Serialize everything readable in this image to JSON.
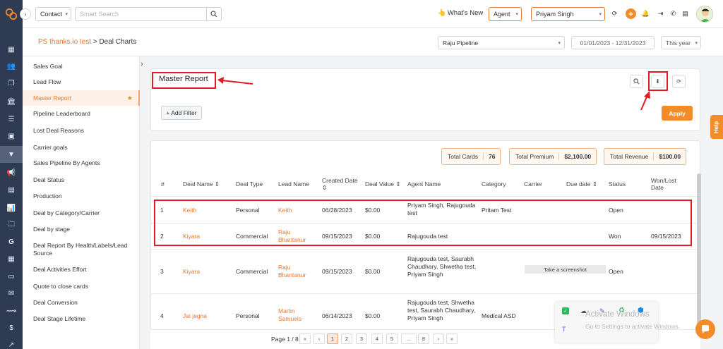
{
  "topbar": {
    "contact_select": "Contact",
    "search_placeholder": "Smart Search",
    "whats_new": "What's New",
    "agent_select": "Agent",
    "user_select": "Priyam Singh"
  },
  "breadcrumb": {
    "parent": "PS thanks.io test",
    "separator": " > ",
    "current": "Deal Charts"
  },
  "filters": {
    "pipeline": "Raju Pipeline",
    "date_range": "01/01/2023 - 12/31/2023",
    "period": "This year"
  },
  "menu": {
    "items": [
      {
        "label": "Sales Goal"
      },
      {
        "label": "Lead Flow"
      },
      {
        "label": "Master Report",
        "active": true
      },
      {
        "label": "Pipeline Leaderboard"
      },
      {
        "label": "Lost Deal Reasons"
      },
      {
        "label": "Carrier goals"
      },
      {
        "label": "Sales Pipeline By Agents"
      },
      {
        "label": "Deal Status"
      },
      {
        "label": "Production"
      },
      {
        "label": "Deal by Category/Carrier"
      },
      {
        "label": "Deal by stage"
      },
      {
        "label": "Deal Report By Health/Labels/Lead Source"
      },
      {
        "label": "Deal Activities Effort"
      },
      {
        "label": "Quote to close cards"
      },
      {
        "label": "Deal Conversion"
      },
      {
        "label": "Deal Stage Lifetime"
      }
    ]
  },
  "report": {
    "title": "Master Report",
    "add_filter": "+ Add Filter",
    "apply": "Apply",
    "help": "Help"
  },
  "stats": {
    "total_cards_label": "Total Cards",
    "total_cards_value": "76",
    "total_premium_label": "Total Premium",
    "total_premium_value": "$2,100.00",
    "total_revenue_label": "Total Revenue",
    "total_revenue_value": "$100.00"
  },
  "table": {
    "headers": {
      "num": "#",
      "deal_name": "Deal Name ⇕",
      "deal_type": "Deal Type",
      "lead_name": "Lead Name",
      "created_date": "Created Date ⇕",
      "deal_value": "Deal Value ⇕",
      "agent_name": "Agent Name",
      "category": "Category",
      "carrier": "Carrier",
      "due_date": "Due date ⇕",
      "status": "Status",
      "won_lost_date": "Won/Lost Date"
    },
    "rows": [
      {
        "num": "1",
        "deal_name": "Keith",
        "deal_type": "Personal",
        "lead_name": "Keith",
        "created_date": "06/28/2023",
        "deal_value": "$0.00",
        "agent_name": "Priyam Singh, Rajugouda test",
        "category": "Pritam Test",
        "carrier": "",
        "due_date": "",
        "status": "Open",
        "won_lost_date": ""
      },
      {
        "num": "2",
        "deal_name": "Kiyara",
        "deal_type": "Commercial",
        "lead_name": "Raju Bhantanur",
        "created_date": "09/15/2023",
        "deal_value": "$0.00",
        "agent_name": "Rajugouda test",
        "category": "",
        "carrier": "",
        "due_date": "",
        "status": "Won",
        "won_lost_date": "09/15/2023"
      },
      {
        "num": "3",
        "deal_name": "Kiyara",
        "deal_type": "Commercial",
        "lead_name": "Raju Bhantanur",
        "created_date": "09/15/2023",
        "deal_value": "$0.00",
        "agent_name": "Rajugouda test, Saurabh Chaudhary, Shwetha test, Priyam Singh",
        "category": "",
        "carrier": "",
        "due_date": "",
        "status": "Open",
        "won_lost_date": ""
      },
      {
        "num": "4",
        "deal_name": "Jai jagna",
        "deal_type": "Personal",
        "lead_name": "Martin Samuels",
        "created_date": "06/14/2023",
        "deal_value": "$0.00",
        "agent_name": "Rajugouda test, Shwetha test, Saurabh Chaudhary, Priyam Singh",
        "category": "Medical ASD",
        "carrier": "",
        "due_date": "",
        "status": "",
        "won_lost_date": ""
      }
    ]
  },
  "tooltip": "Take a screenshot",
  "pagination": {
    "label": "Page 1 / 8",
    "first": "«",
    "prev": "‹",
    "pages": [
      "1",
      "2",
      "3",
      "4",
      "5",
      "...",
      "8"
    ],
    "next": "›",
    "last": "»"
  },
  "windows": {
    "activate_title": "Activate Windows",
    "activate_sub": "Go to Settings to activate Windows."
  },
  "colors": {
    "accent": "#f28c28",
    "link": "#e8762d",
    "highlight": "#e01b24",
    "rail": "#2f3b52"
  }
}
